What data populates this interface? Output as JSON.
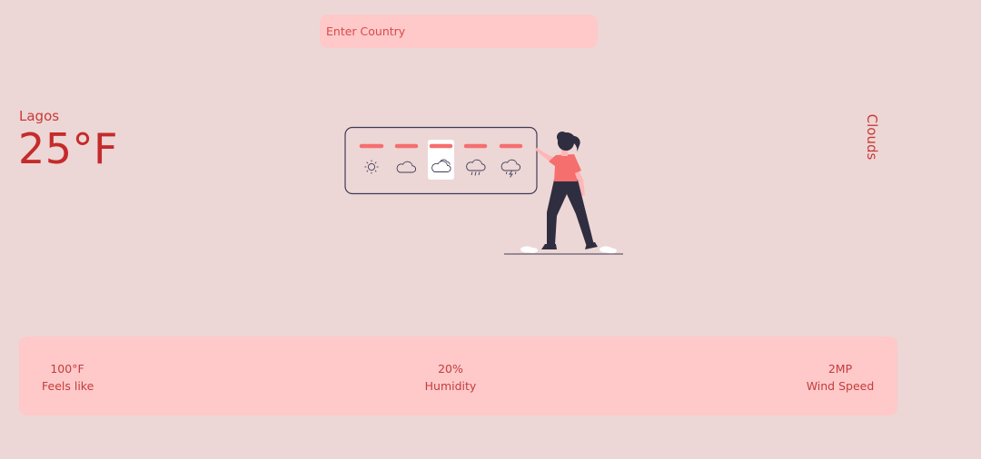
{
  "search": {
    "placeholder": "Enter Country"
  },
  "weather": {
    "city": "Lagos",
    "temperature": "25°F",
    "condition": "Clouds"
  },
  "illustration": {
    "icons": [
      "sun-icon",
      "cloud-icon",
      "partly-cloudy-icon",
      "rain-icon",
      "thunderstorm-icon"
    ],
    "selected_icon": "partly-cloudy-icon"
  },
  "stats": {
    "feels_like": {
      "value": "100°F",
      "label": "Feels like"
    },
    "humidity": {
      "value": "20%",
      "label": "Humidity"
    },
    "wind_speed": {
      "value": "2MP",
      "label": "Wind Speed"
    }
  },
  "colors": {
    "background": "#ecd6d6",
    "panel": "#ffc9c9",
    "accent": "#c52b2b",
    "bar": "#f56f6f",
    "dark": "#2f2e41"
  }
}
